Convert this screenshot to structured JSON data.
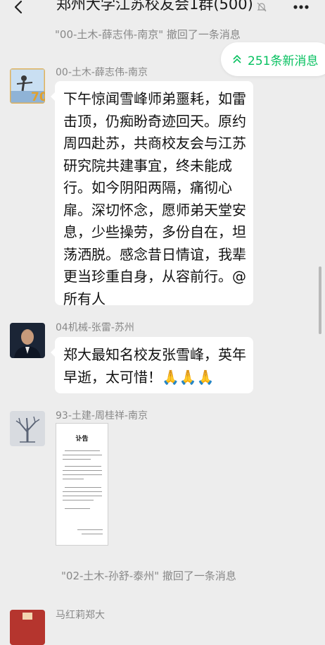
{
  "header": {
    "title": "郑州大学江苏校友会1群(500)",
    "back_icon": "back-arrow-icon",
    "mute_icon": "mute-bell-icon",
    "more_icon": "more-dots-icon"
  },
  "system_messages": [
    "\"00-土木-薛志伟-南京\" 撤回了一条消息",
    "\"02-土木-孙舒-泰州\" 撤回了一条消息"
  ],
  "new_messages": {
    "label": "251条新消息",
    "color": "#07c160",
    "icon": "double-chevron-up-icon"
  },
  "messages": [
    {
      "sender": "00-土木-薛志伟-南京",
      "avatar_icon": "photo-avatar-70-icon",
      "text": "下午惊闻雪峰师弟噩耗，如雷击顶，仍痴盼奇迹回天。原约周四赴苏，共商校友会与江苏研究院共建事宜，终未能成行。如今阴阳两隔，痛彻心扉。深切怀念，愿师弟天堂安息，少些操劳，多份自在，坦荡洒脱。感念昔日情谊，我辈更当珍重自身，从容前行。@所有人"
    },
    {
      "sender": "04机械-张雷-苏州",
      "avatar_icon": "portrait-avatar-icon",
      "text": "郑大最知名校友张雪峰，英年早逝，太可惜！🙏🙏🙏"
    },
    {
      "sender": "93-土建-周桂祥-南京",
      "avatar_icon": "tree-avatar-icon",
      "image_title": "讣告"
    },
    {
      "sender": "马红莉郑大",
      "avatar_icon": "red-avatar-icon"
    }
  ]
}
